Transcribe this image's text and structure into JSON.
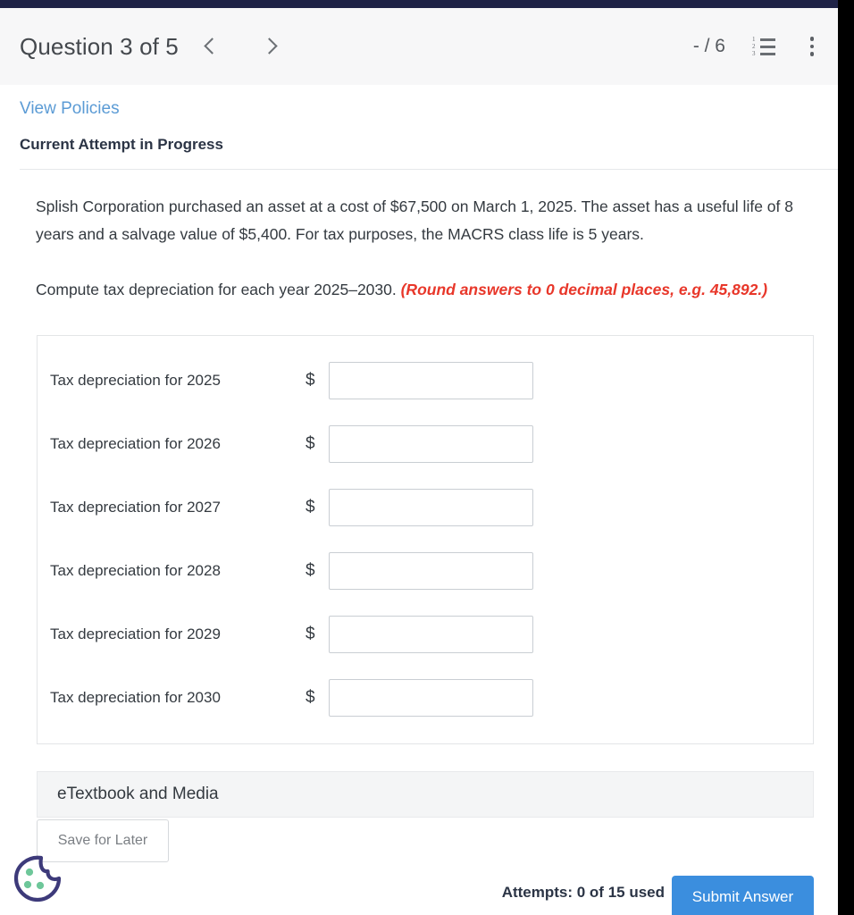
{
  "header": {
    "question_title": "Question 3 of 5",
    "prev_icon": "chevron-left-icon",
    "next_icon": "chevron-right-icon",
    "score": "- / 6",
    "list_icon": "numbered-list-icon",
    "menu_icon": "kebab-menu-icon"
  },
  "attempt": {
    "policies_link": "View Policies",
    "status": "Current Attempt in Progress"
  },
  "question": {
    "paragraph1": "Splish Corporation purchased an asset at a cost of $67,500 on March 1, 2025. The asset has a useful life of 8 years and a salvage value of $5,400. For tax purposes, the MACRS class life is 5 years.",
    "paragraph2_main": "Compute tax depreciation for each year 2025–2030. ",
    "paragraph2_hint": "(Round answers to 0 decimal places, e.g. 45,892.)"
  },
  "answers": {
    "currency_symbol": "$",
    "rows": [
      {
        "label": "Tax depreciation for 2025",
        "value": "",
        "placeholder": ""
      },
      {
        "label": "Tax depreciation for 2026",
        "value": "",
        "placeholder": ""
      },
      {
        "label": "Tax depreciation for 2027",
        "value": "",
        "placeholder": ""
      },
      {
        "label": "Tax depreciation for 2028",
        "value": "",
        "placeholder": ""
      },
      {
        "label": "Tax depreciation for 2029",
        "value": "",
        "placeholder": ""
      },
      {
        "label": "Tax depreciation for 2030",
        "value": "",
        "placeholder": ""
      }
    ]
  },
  "etextbook": {
    "label": "eTextbook and Media"
  },
  "footer": {
    "save_label": "Save for Later",
    "attempts_text": "Attempts: 0 of 15 used",
    "submit_label": "Submit Answer"
  },
  "cookie": {
    "icon": "cookie-consent-icon"
  },
  "colors": {
    "link_blue": "#5b9bd5",
    "submit_blue": "#3b8ede",
    "hint_red": "#e8372a",
    "top_bar_navy": "#1f2347",
    "cookie_outline": "#3d3a7a",
    "cookie_dots": "#6ec79a"
  }
}
